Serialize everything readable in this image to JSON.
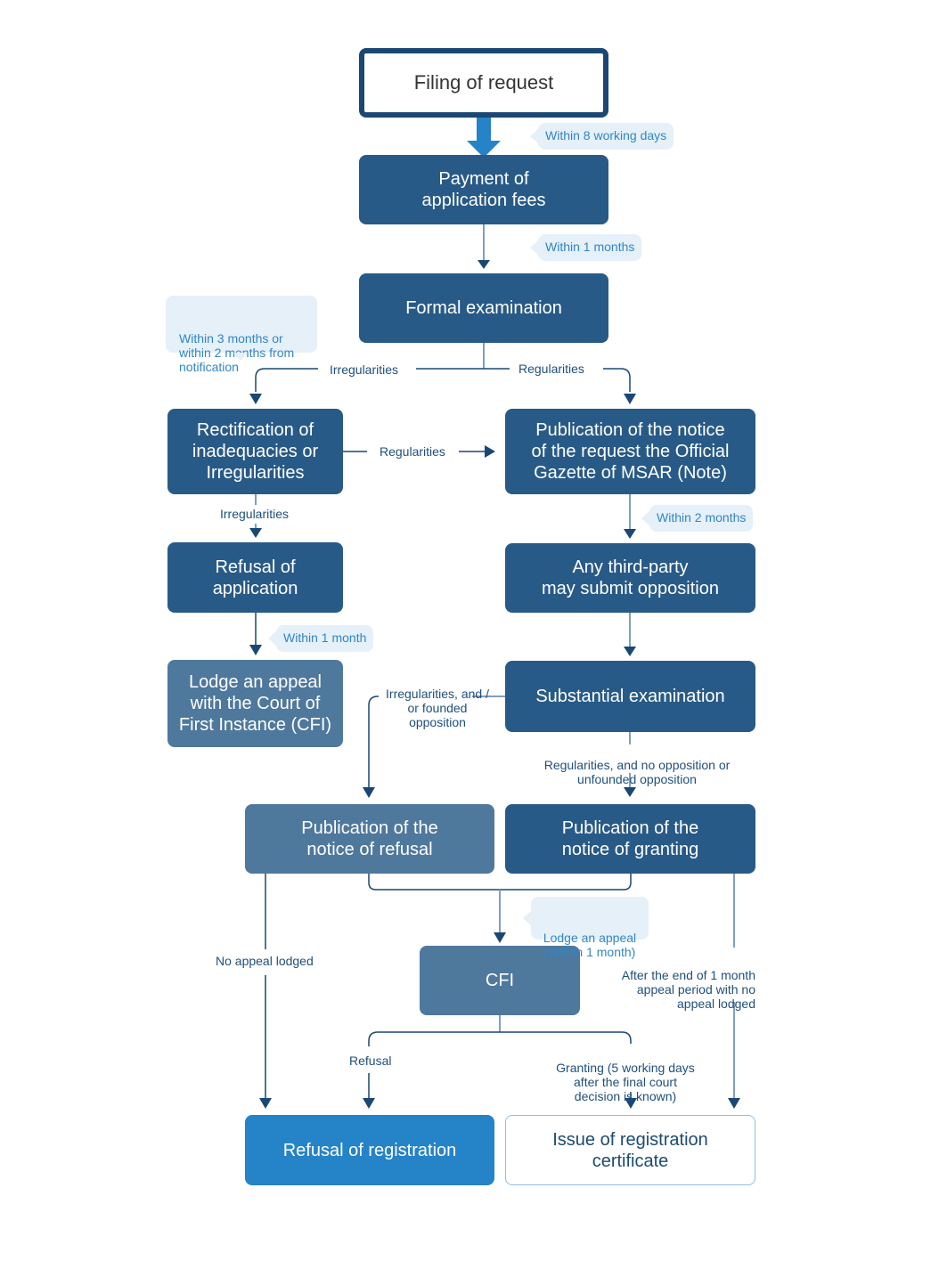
{
  "colors": {
    "dark_box": "#285a87",
    "mid_box": "#4f789d",
    "bright_box": "#2583c7",
    "start_border": "#1a4773",
    "bubble_bg": "#e6f0f9",
    "bubble_text": "#2f86c7",
    "label_text": "#1f4f7c",
    "connector": "#7f9fbd",
    "arrowhead": "#1a4773"
  },
  "nodes": {
    "filing": "Filing of request",
    "payment": "Payment of\napplication fees",
    "formal_exam": "Formal examination",
    "rectification": "Rectification of\ninadequacies or\nIrregularities",
    "publication_request": "Publication of the notice\nof the request the Official\nGazette of MSAR  (Note)",
    "refusal_application": "Refusal of\napplication",
    "third_party": "Any third-party\nmay submit opposition",
    "lodge_appeal_cfi": "Lodge an appeal\nwith the Court of\nFirst Instance (CFI)",
    "substantial_exam": "Substantial examination",
    "publication_refusal": "Publication of the\nnotice of refusal",
    "publication_granting": "Publication of the\nnotice of granting",
    "cfi": "CFI",
    "refusal_registration": "Refusal of registration",
    "issue_certificate": "Issue of registration\ncertificate"
  },
  "bubbles": {
    "within_8_working_days": "Within 8 working days",
    "within_1_months": "Within 1 months",
    "within_3_months": "Within 3 months or\nwithin 2 months from\nnotification",
    "within_2_months": "Within 2 months",
    "within_1_month": "Within 1 month",
    "lodge_appeal_within": "Lodge an appeal\n(Within 1 month)"
  },
  "labels": {
    "irregularities_top": "Irregularities",
    "regularities_top": "Regularities",
    "regularities_mid": "Regularities",
    "irregularities_mid": "Irregularities",
    "irregularities_founded": "Irregularities, and /\nor founded\nopposition",
    "regularities_no_opposition": "Regularities, and no opposition or\nunfounded opposition",
    "no_appeal_lodged": "No appeal lodged",
    "after_end_period": "After the end of 1 month\nappeal period with no\nappeal lodged",
    "refusal": "Refusal",
    "granting": "Granting (5 working days\nafter the final court\ndecision is known)"
  }
}
